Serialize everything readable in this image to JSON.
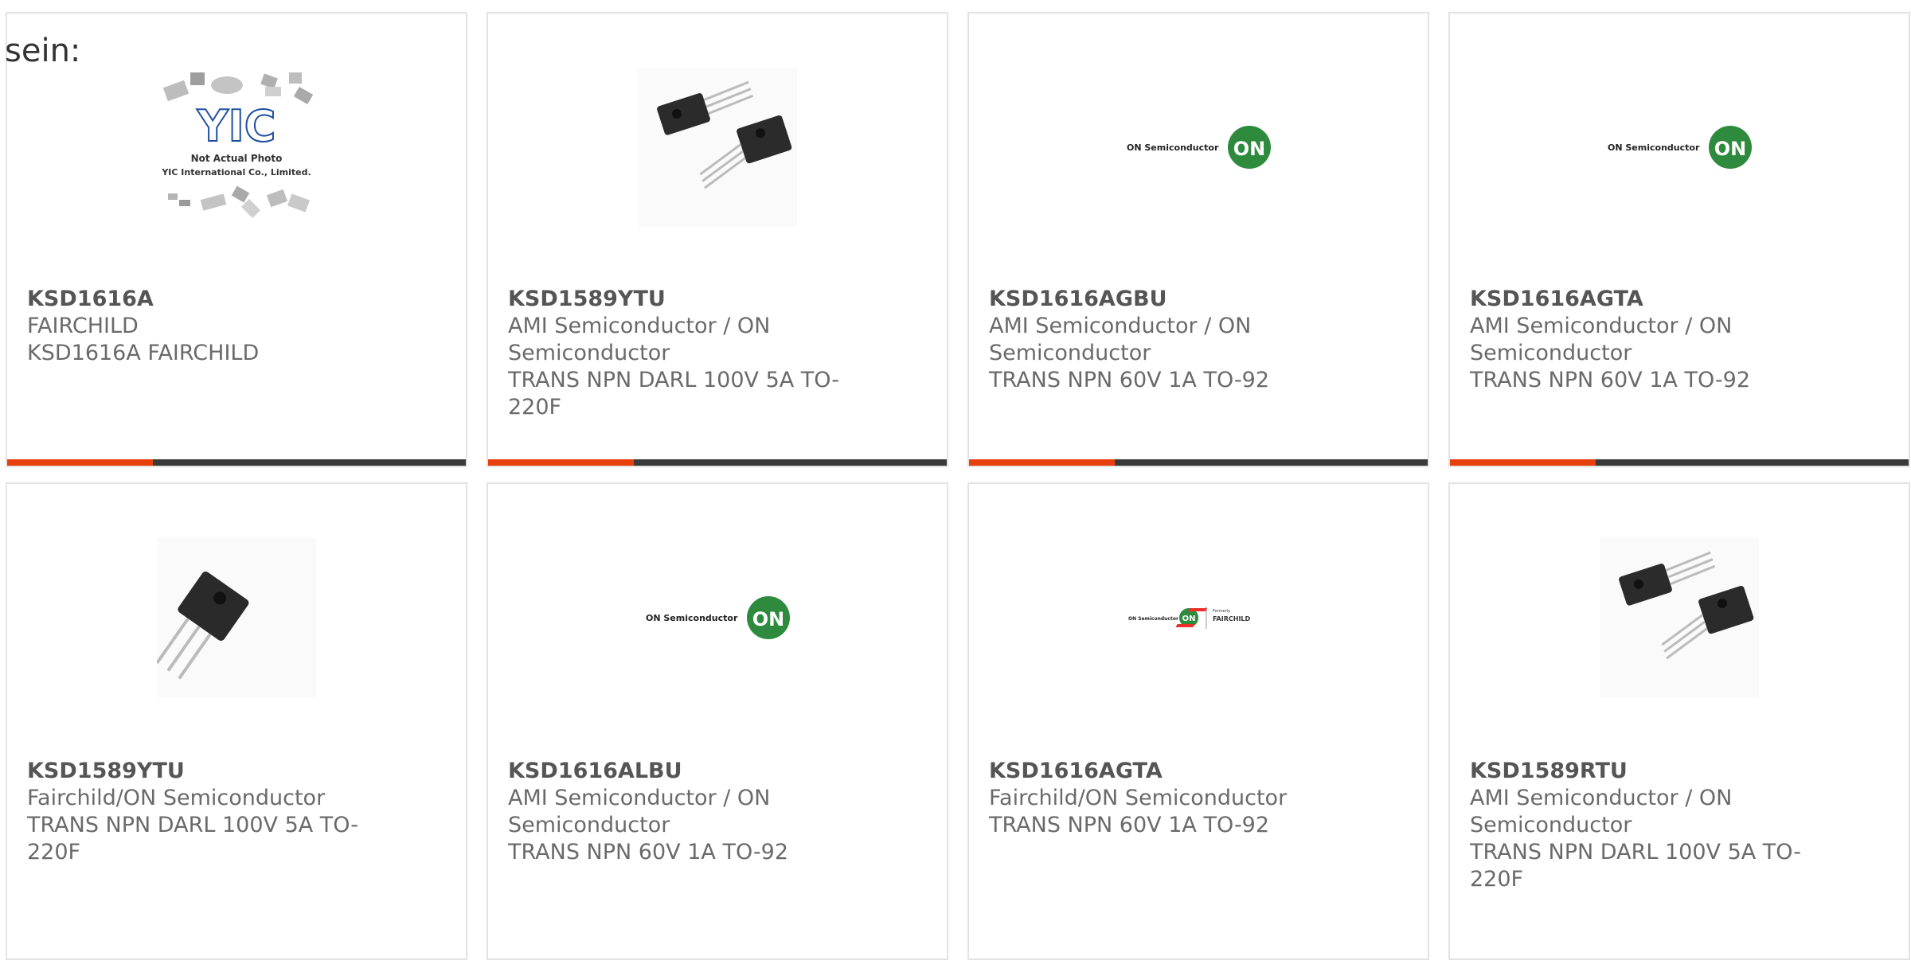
{
  "intro_text": "sein:",
  "products": [
    {
      "part_number": "KSD1616A",
      "manufacturer": "FAIRCHILD",
      "description": "KSD1616A FAIRCHILD",
      "image_type": "yic-placeholder",
      "placeholder_caption_1": "Not Actual Photo",
      "placeholder_caption_2": "YIC International Co., Limited.",
      "placeholder_logo_text": "YIC"
    },
    {
      "part_number": "KSD1589YTU",
      "manufacturer": "AMI Semiconductor / ON Semiconductor",
      "description": "TRANS NPN DARL 100V 5A TO-220F",
      "image_type": "to220-pair"
    },
    {
      "part_number": "KSD1616AGBU",
      "manufacturer": "AMI Semiconductor / ON Semiconductor",
      "description": "TRANS NPN 60V 1A TO-92",
      "image_type": "on-logo",
      "logo_text": "ON Semiconductor",
      "logo_badge": "ON"
    },
    {
      "part_number": "KSD1616AGTA",
      "manufacturer": "AMI Semiconductor / ON Semiconductor",
      "description": "TRANS NPN 60V 1A TO-92",
      "image_type": "on-logo",
      "logo_text": "ON Semiconductor",
      "logo_badge": "ON"
    },
    {
      "part_number": "KSD1589YTU",
      "manufacturer": "Fairchild/ON Semiconductor",
      "description": "TRANS NPN DARL 100V 5A TO-220F",
      "image_type": "to220-single"
    },
    {
      "part_number": "KSD1616ALBU",
      "manufacturer": "AMI Semiconductor / ON Semiconductor",
      "description": "TRANS NPN 60V 1A TO-92",
      "image_type": "on-logo",
      "logo_text": "ON Semiconductor",
      "logo_badge": "ON"
    },
    {
      "part_number": "KSD1616AGTA",
      "manufacturer": "Fairchild/ON Semiconductor",
      "description": "TRANS NPN 60V 1A TO-92",
      "image_type": "on-fairchild-logo",
      "logo_text": "ON Semiconductor",
      "logo_badge": "ON",
      "formerly_text": "Formerly",
      "fairchild_text": "FAIRCHILD"
    },
    {
      "part_number": "KSD1589RTU",
      "manufacturer": "AMI Semiconductor / ON Semiconductor",
      "description": "TRANS NPN DARL 100V 5A TO-220F",
      "image_type": "to220-pair"
    }
  ],
  "colors": {
    "accent": "#e8400c",
    "bar": "#3a3a3a",
    "on_green": "#2e8b3e"
  }
}
